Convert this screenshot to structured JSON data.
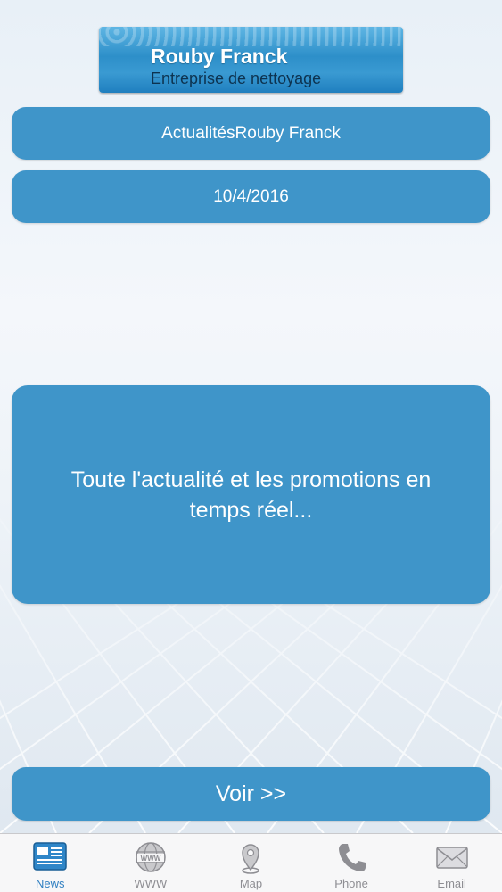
{
  "header": {
    "logo_title": "Rouby Franck",
    "logo_subtitle": "Entreprise de nettoyage"
  },
  "news": {
    "title": "ActualitésRouby Franck",
    "date": "10/4/2016",
    "body": "Toute l'actualité et les promotions en temps réel...",
    "action_label": "Voir >>"
  },
  "tabbar": {
    "active": "News",
    "tabs": [
      {
        "label": "News",
        "icon": "newspaper-icon"
      },
      {
        "label": "WWW",
        "icon": "globe-icon"
      },
      {
        "label": "Map",
        "icon": "map-pin-icon"
      },
      {
        "label": "Phone",
        "icon": "phone-icon"
      },
      {
        "label": "Email",
        "icon": "envelope-icon"
      }
    ]
  },
  "colors": {
    "accent": "#3f95c9",
    "tab_active": "#2f7fc1",
    "tab_inactive": "#8e8e93"
  }
}
